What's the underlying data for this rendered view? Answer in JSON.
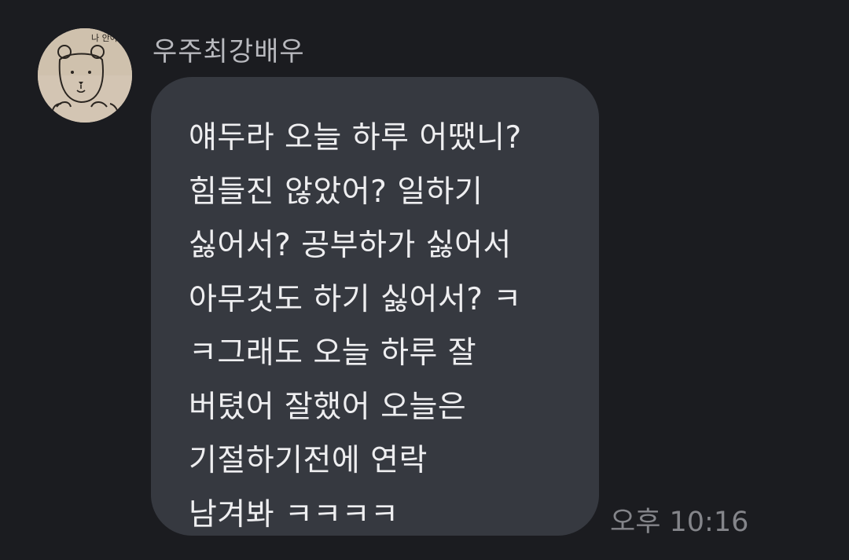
{
  "message": {
    "sender": {
      "name": "우주최강배우",
      "avatar_text": "나 안아"
    },
    "lines": [
      "얘두라 오늘 하루 어땠니?",
      "힘들진 않았어? 일하기",
      "싫어서? 공부하가 싫어서",
      "아무것도 하기 싫어서? ㅋ",
      "ㅋ그래도 오늘 하루 잘",
      "버텼어 잘했어 오늘은",
      "기절하기전에 연락",
      "남겨봐 ㅋㅋㅋㅋ"
    ],
    "time": "오후 10:16"
  }
}
